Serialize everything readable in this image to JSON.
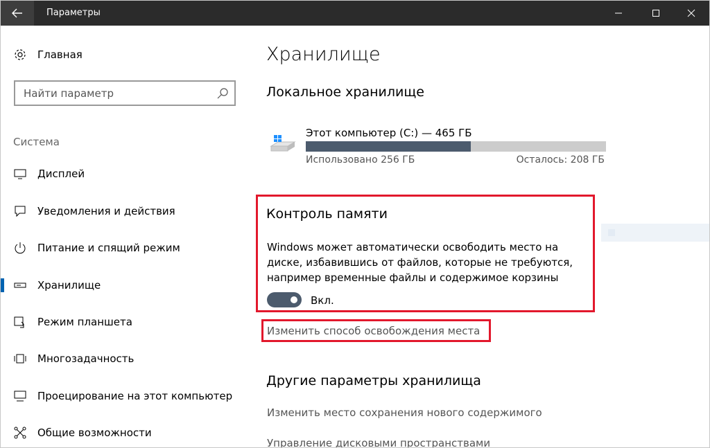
{
  "window": {
    "title": "Параметры"
  },
  "sidebar": {
    "home_label": "Главная",
    "search_placeholder": "Найти параметр",
    "group_label": "Система",
    "items": [
      {
        "label": "Дисплей",
        "icon": "monitor-icon"
      },
      {
        "label": "Уведомления и действия",
        "icon": "notification-icon"
      },
      {
        "label": "Питание и спящий режим",
        "icon": "power-icon"
      },
      {
        "label": "Хранилище",
        "icon": "storage-icon",
        "selected": true
      },
      {
        "label": "Режим планшета",
        "icon": "tablet-mode-icon"
      },
      {
        "label": "Многозадачность",
        "icon": "multitasking-icon"
      },
      {
        "label": "Проецирование на этот компьютер",
        "icon": "projecting-icon"
      },
      {
        "label": "Общие возможности",
        "icon": "shared-experiences-icon"
      }
    ]
  },
  "main": {
    "title": "Хранилище",
    "local_storage_heading": "Локальное хранилище",
    "drive": {
      "name": "Этот компьютер (C:) — 465 ГБ",
      "used_label": "Использовано 256 ГБ",
      "free_label": "Осталось: 208 ГБ",
      "used_fraction": 0.55
    },
    "storage_sense": {
      "heading": "Контроль памяти",
      "description": "Windows может автоматически освободить место на диске, избавившись от файлов, которые не требуются, например временные файлы и содержимое корзины",
      "toggle_label": "Вкл.",
      "toggle_on": true
    },
    "change_link": "Изменить способ освобождения места",
    "other_heading": "Другие параметры хранилища",
    "other_links": [
      "Изменить место сохранения нового содержимого",
      "Управление дисковыми пространствами"
    ]
  },
  "colors": {
    "accent": "#0063b1",
    "highlight": "#e2182c",
    "bar_fill": "#4c5b6d",
    "bar_track": "#cccccc",
    "titlebar": "#2b2b2b"
  }
}
